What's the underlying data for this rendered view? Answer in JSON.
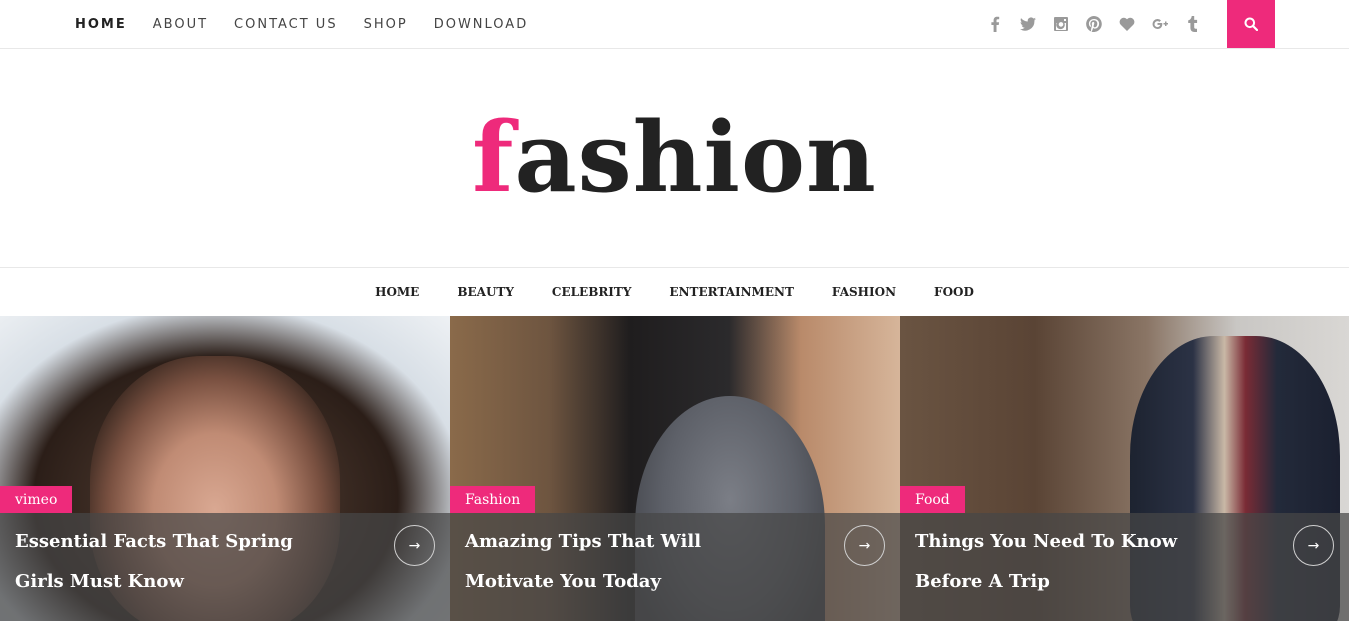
{
  "top_nav": {
    "items": [
      {
        "label": "HOME",
        "active": true
      },
      {
        "label": "ABOUT"
      },
      {
        "label": "CONTACT US"
      },
      {
        "label": "SHOP"
      },
      {
        "label": "DOWNLOAD"
      }
    ]
  },
  "social_icons": [
    "facebook-icon",
    "twitter-icon",
    "instagram-icon",
    "pinterest-icon",
    "heart-icon",
    "google-plus-icon",
    "tumblr-icon"
  ],
  "search": {
    "icon": "search-icon"
  },
  "logo": {
    "accent": "f",
    "rest": "ashion"
  },
  "category_nav": {
    "items": [
      "HOME",
      "BEAUTY",
      "CELEBRITY",
      "ENTERTAINMENT",
      "FASHION",
      "FOOD"
    ]
  },
  "slides": [
    {
      "tag": "vimeo",
      "title": "Essential Facts That Spring Girls Must Know",
      "arrow": "→"
    },
    {
      "tag": "Fashion",
      "title": "Amazing Tips That Will Motivate You Today",
      "arrow": "→"
    },
    {
      "tag": "Food",
      "title": "Things You Need To Know Before A Trip",
      "arrow": "→"
    }
  ],
  "colors": {
    "accent": "#ee2a7b",
    "text": "#222222",
    "muted": "#9a9a9a"
  }
}
